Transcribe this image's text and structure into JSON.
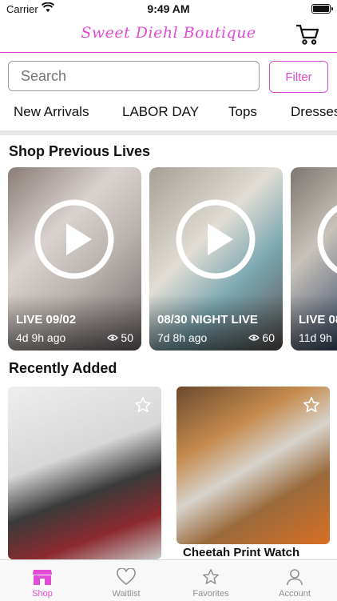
{
  "status_bar": {
    "carrier": "Carrier",
    "time": "9:49 AM"
  },
  "header": {
    "brand": "Sweet Diehl Boutique"
  },
  "search": {
    "placeholder": "Search",
    "filter_label": "Filter"
  },
  "categories": [
    "New Arrivals",
    "LABOR DAY",
    "Tops",
    "Dresses"
  ],
  "sections": {
    "lives_title": "Shop Previous Lives",
    "recent_title": "Recently Added"
  },
  "lives": [
    {
      "title": "LIVE 09/02",
      "age": "4d 9h ago",
      "views": "50"
    },
    {
      "title": "08/30 NIGHT LIVE",
      "age": "7d 8h ago",
      "views": "60"
    },
    {
      "title": "LIVE 08",
      "age": "11d 9h"
    }
  ],
  "products": [
    {
      "name": ""
    },
    {
      "name": "Cheetah Print Watch"
    }
  ],
  "tabbar": {
    "tabs": [
      "Shop",
      "Waitlist",
      "Favorites",
      "Account"
    ]
  },
  "colors": {
    "accent": "#e24bd3",
    "tab_inactive": "#8e8e93"
  }
}
